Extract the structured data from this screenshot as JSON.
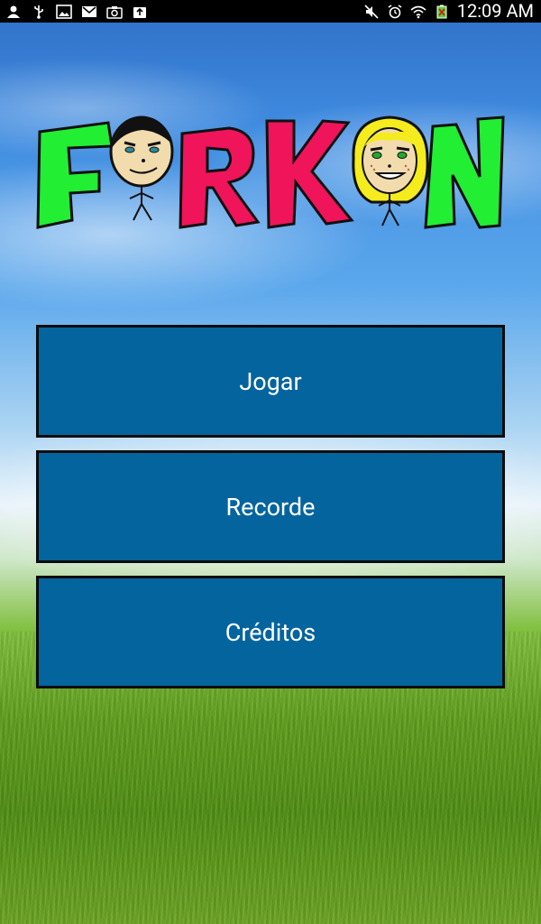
{
  "status_bar": {
    "left_icons": [
      "person-icon",
      "usb-icon",
      "image-icon",
      "gmail-icon",
      "camera-icon",
      "upload-icon"
    ],
    "right_icons": [
      "mute-icon",
      "alarm-icon",
      "wifi-icon",
      "battery-icon"
    ],
    "time": "12:09 AM"
  },
  "logo": {
    "text": "FORKON",
    "colors": {
      "green": "#22ee33",
      "pink": "#f0145a"
    }
  },
  "menu": {
    "buttons": [
      {
        "label": "Jogar"
      },
      {
        "label": "Recorde"
      },
      {
        "label": "Créditos"
      }
    ],
    "button_color": "#04649e"
  }
}
